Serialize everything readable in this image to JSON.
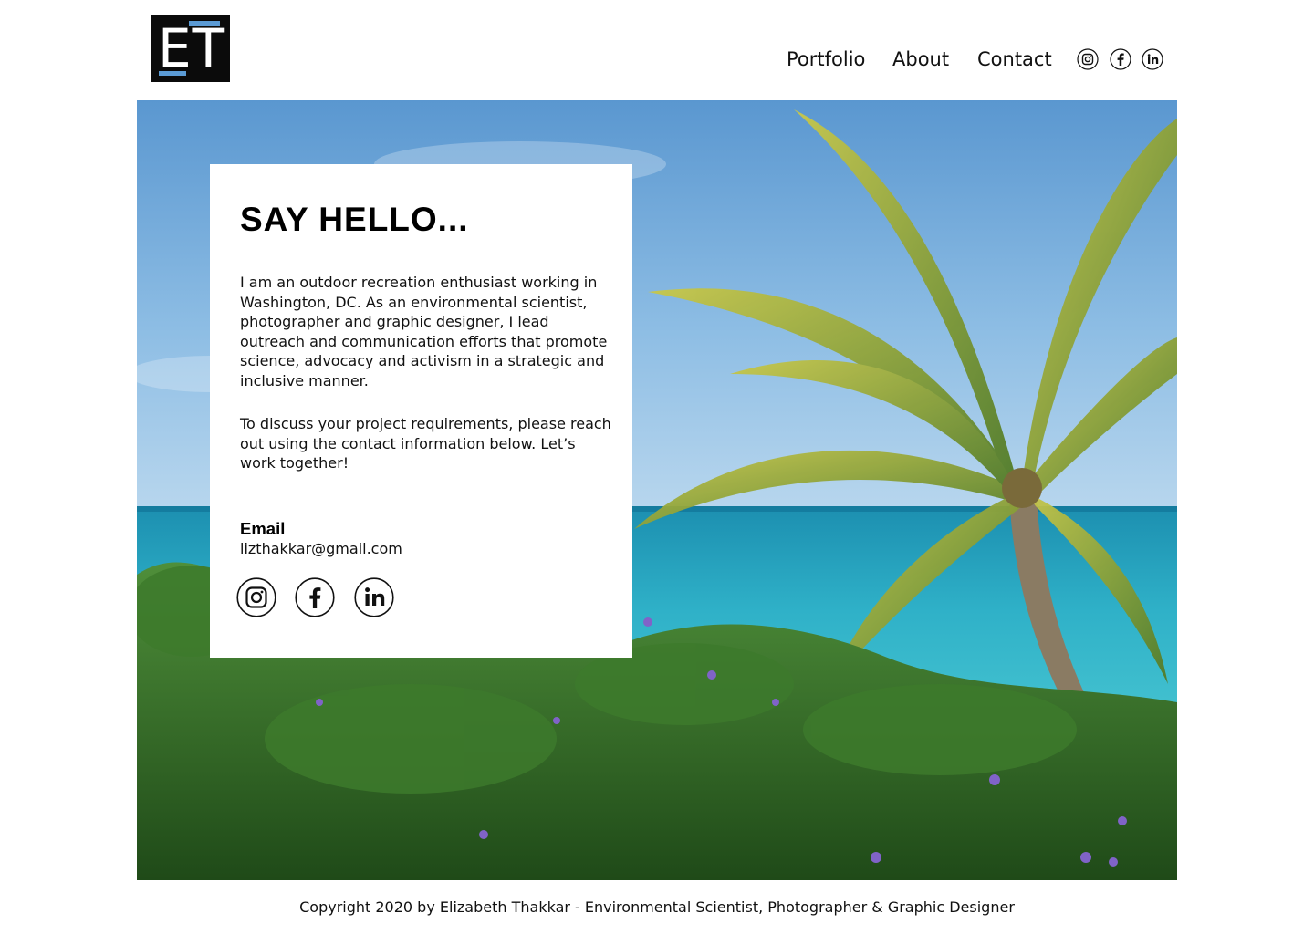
{
  "header": {
    "logo_text": "ET",
    "nav": [
      {
        "label": "Portfolio"
      },
      {
        "label": "About"
      },
      {
        "label": "Contact"
      }
    ],
    "social_icons": [
      "instagram-icon",
      "facebook-icon",
      "linkedin-icon"
    ]
  },
  "card": {
    "title": "SAY HELLO...",
    "paragraph1": "I am an outdoor recreation enthusiast working in Washington, DC. As an environmental scientist, photographer and graphic designer, I lead outreach and communication efforts that promote science, advocacy and activism in a strategic and inclusive manner.",
    "paragraph2": "To discuss your project requirements, please reach out using the contact information below. Let’s work together!",
    "email_label": "Email",
    "email_value": "lizthakkar@gmail.com",
    "social_icons": [
      "instagram-icon",
      "facebook-icon",
      "linkedin-icon"
    ]
  },
  "footer": {
    "copyright": "Copyright 2020 by Elizabeth Thakkar - Environmental Scientist, Photographer & Graphic Designer"
  },
  "colors": {
    "logo_bg": "#0b0b0b",
    "logo_accent": "#5b9bd5",
    "text": "#111111",
    "card_bg": "#ffffff"
  }
}
